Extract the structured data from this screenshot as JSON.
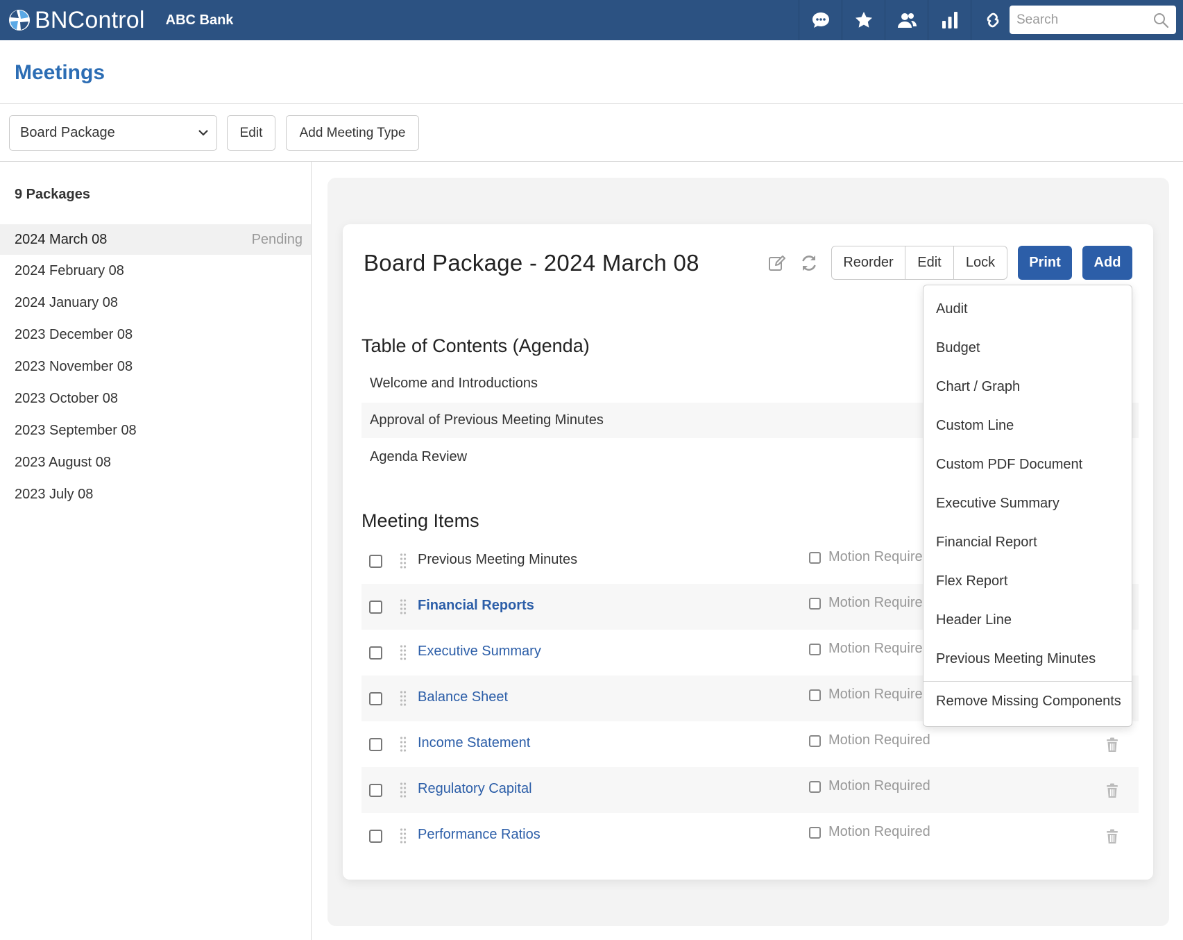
{
  "app": {
    "brand": "BNControl",
    "bank": "ABC Bank"
  },
  "topbar": {
    "icons": [
      "chat-icon",
      "star-icon",
      "users-icon",
      "bar-chart-icon",
      "link-icon"
    ],
    "search_placeholder": "Search"
  },
  "page": {
    "title": "Meetings"
  },
  "toolbar": {
    "meeting_type": "Board Package",
    "edit_label": "Edit",
    "add_type_label": "Add Meeting Type"
  },
  "sidebar": {
    "count_label": "9 Packages",
    "items": [
      {
        "label": "2024 March 08",
        "status": "Pending"
      },
      {
        "label": "2024 February 08",
        "status": ""
      },
      {
        "label": "2024 January 08",
        "status": ""
      },
      {
        "label": "2023 December 08",
        "status": ""
      },
      {
        "label": "2023 November 08",
        "status": ""
      },
      {
        "label": "2023 October 08",
        "status": ""
      },
      {
        "label": "2023 September 08",
        "status": ""
      },
      {
        "label": "2023 August 08",
        "status": ""
      },
      {
        "label": "2023 July 08",
        "status": ""
      }
    ]
  },
  "card": {
    "title": "Board Package - 2024 March 08",
    "icons": [
      "edit-note-icon",
      "refresh-icon"
    ],
    "buttons": {
      "reorder": "Reorder",
      "edit": "Edit",
      "lock": "Lock",
      "print": "Print",
      "add": "Add"
    },
    "agenda_title": "Table of Contents (Agenda)",
    "agenda": [
      "Welcome and Introductions",
      "Approval of Previous Meeting Minutes",
      "Agenda Review"
    ],
    "items_title": "Meeting Items",
    "items": [
      {
        "label": "Previous Meeting Minutes",
        "motion": "Motion Require"
      },
      {
        "label": "Financial Reports",
        "motion": "Motion Require"
      },
      {
        "label": "Executive Summary",
        "motion": "Motion Require"
      },
      {
        "label": "Balance Sheet",
        "motion": "Motion Require"
      },
      {
        "label": "Income Statement",
        "motion": "Motion Required"
      },
      {
        "label": "Regulatory Capital",
        "motion": "Motion Required"
      },
      {
        "label": "Performance Ratios",
        "motion": "Motion Required"
      }
    ]
  },
  "add_menu": {
    "items": [
      "Audit",
      "Budget",
      "Chart / Graph",
      "Custom Line",
      "Custom PDF Document",
      "Executive Summary",
      "Financial Report",
      "Flex Report",
      "Header Line",
      "Previous Meeting Minutes"
    ],
    "footer": "Remove Missing Components"
  },
  "colors": {
    "topbar": "#2c5282",
    "accent": "#2c5ea8",
    "link": "#2c5ea8"
  }
}
